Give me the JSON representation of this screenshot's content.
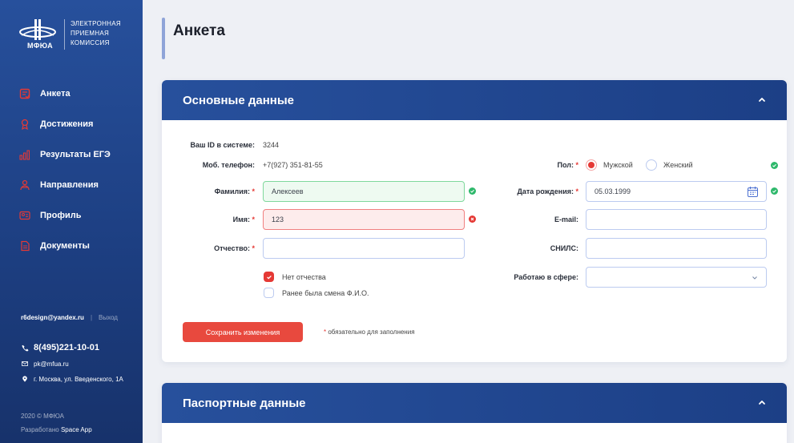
{
  "sidebar": {
    "logo_abbr": "МФЮА",
    "logo_text": [
      "ЭЛЕКТРОННАЯ",
      "ПРИЕМНАЯ",
      "КОМИССИЯ"
    ],
    "items": [
      {
        "label": "Анкета",
        "icon": "form-icon",
        "active": true
      },
      {
        "label": "Достижения",
        "icon": "medal-icon"
      },
      {
        "label": "Результаты ЕГЭ",
        "icon": "bar-chart-icon"
      },
      {
        "label": "Направления",
        "icon": "directions-icon"
      },
      {
        "label": "Профиль",
        "icon": "profile-card-icon"
      },
      {
        "label": "Документы",
        "icon": "documents-icon"
      }
    ],
    "user_email": "r6design@yandex.ru",
    "logout": "Выход",
    "phone": "8(495)221-10-01",
    "contact_email": "pk@mfua.ru",
    "address": "г. Москва, ул. Введенского, 1А",
    "copyright": "2020 © МФЮА",
    "developed_by_prefix": "Разработано ",
    "developed_by": "Space App",
    "accent_color": "#e53935"
  },
  "page": {
    "title": "Анкета"
  },
  "main_section": {
    "title": "Основные данные",
    "id_label": "Ваш ID в системе:",
    "id_value": "3244",
    "phone_label": "Моб. телефон:",
    "phone_value": "+7(927) 351-81-55",
    "surname_label": "Фамилия:",
    "surname_value": "Алексеев",
    "name_label": "Имя:",
    "name_value": "123",
    "patronymic_label": "Отчество:",
    "patronymic_value": "",
    "no_patronymic": "Нет отчества",
    "no_patronymic_checked": true,
    "name_changed": "Ранее была смена Ф.И.О.",
    "name_changed_checked": false,
    "gender_label": "Пол:",
    "gender_male": "Мужской",
    "gender_female": "Женский",
    "gender_selected": "Мужской",
    "birth_label": "Дата рождения:",
    "birth_value": "05.03.1999",
    "email_label": "E-mail:",
    "email_value": "",
    "snils_label": "СНИЛС:",
    "snils_value": "",
    "work_label": "Работаю в сфере:",
    "work_value": "",
    "save_button": "Сохранить изменения",
    "required_note": "обязательно для заполнения"
  },
  "passport_section": {
    "title": "Паспортные данные"
  }
}
